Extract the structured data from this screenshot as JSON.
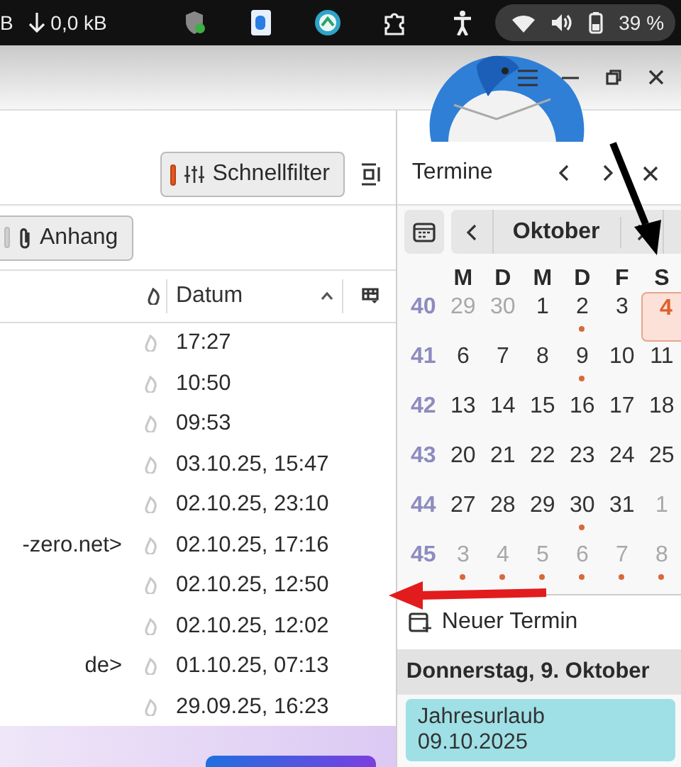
{
  "top_bar": {
    "net_fragment": "B",
    "download": "0,0 kB",
    "battery": "39 %"
  },
  "toolbar": {
    "quick_filter": {
      "label": "Schnellfilter",
      "on": true
    }
  },
  "filter_bar": {
    "attachment": {
      "label": "Anhang",
      "on": false
    }
  },
  "message_list": {
    "columns": [
      {
        "label": "Datum",
        "sorted": true
      }
    ],
    "rows": [
      {
        "date": "17:27"
      },
      {
        "date": "10:50"
      },
      {
        "date": "09:53"
      },
      {
        "date": "03.10.25, 15:47"
      },
      {
        "date": "02.10.25, 23:10"
      },
      {
        "column_1": "-zero.net>",
        "date": "02.10.25, 17:16"
      },
      {
        "date": "02.10.25, 12:50"
      },
      {
        "date": "02.10.25, 12:02"
      },
      {
        "column_1": "de>",
        "date": "01.10.25, 07:13"
      },
      {
        "date": "29.09.25, 16:23"
      }
    ]
  },
  "today_pane": {
    "title": "Termine",
    "month": "Oktober",
    "weekdays": [
      "M",
      "D",
      "M",
      "D",
      "F",
      "S"
    ],
    "weeks": [
      {
        "number": "40",
        "days": [
          {
            "label": "29",
            "muted": true,
            "event": false,
            "today": false
          },
          {
            "label": "30",
            "muted": true,
            "event": false,
            "today": false
          },
          {
            "label": "1",
            "muted": false,
            "event": false,
            "today": false
          },
          {
            "label": "2",
            "muted": false,
            "event": true,
            "today": false
          },
          {
            "label": "3",
            "muted": false,
            "event": false,
            "today": false
          },
          {
            "label": "4",
            "muted": false,
            "event": false,
            "today": true
          }
        ]
      },
      {
        "number": "41",
        "days": [
          {
            "label": "6",
            "muted": false,
            "event": false,
            "today": false
          },
          {
            "label": "7",
            "muted": false,
            "event": false,
            "today": false
          },
          {
            "label": "8",
            "muted": false,
            "event": false,
            "today": false
          },
          {
            "label": "9",
            "muted": false,
            "event": true,
            "today": false
          },
          {
            "label": "10",
            "muted": false,
            "event": false,
            "today": false
          },
          {
            "label": "11",
            "muted": false,
            "event": false,
            "today": false
          }
        ]
      },
      {
        "number": "42",
        "days": [
          {
            "label": "13",
            "muted": false,
            "event": false,
            "today": false
          },
          {
            "label": "14",
            "muted": false,
            "event": false,
            "today": false
          },
          {
            "label": "15",
            "muted": false,
            "event": false,
            "today": false
          },
          {
            "label": "16",
            "muted": false,
            "event": false,
            "today": false
          },
          {
            "label": "17",
            "muted": false,
            "event": false,
            "today": false
          },
          {
            "label": "18",
            "muted": false,
            "event": false,
            "today": false
          }
        ]
      },
      {
        "number": "43",
        "days": [
          {
            "label": "20",
            "muted": false,
            "event": false,
            "today": false
          },
          {
            "label": "21",
            "muted": false,
            "event": false,
            "today": false
          },
          {
            "label": "22",
            "muted": false,
            "event": false,
            "today": false
          },
          {
            "label": "23",
            "muted": false,
            "event": false,
            "today": false
          },
          {
            "label": "24",
            "muted": false,
            "event": false,
            "today": false
          },
          {
            "label": "25",
            "muted": false,
            "event": false,
            "today": false
          }
        ]
      },
      {
        "number": "44",
        "days": [
          {
            "label": "27",
            "muted": false,
            "event": false,
            "today": false
          },
          {
            "label": "28",
            "muted": false,
            "event": false,
            "today": false
          },
          {
            "label": "29",
            "muted": false,
            "event": false,
            "today": false
          },
          {
            "label": "30",
            "muted": false,
            "event": true,
            "today": false
          },
          {
            "label": "31",
            "muted": false,
            "event": false,
            "today": false
          },
          {
            "label": "1",
            "muted": true,
            "event": false,
            "today": false
          }
        ]
      },
      {
        "number": "45",
        "days": [
          {
            "label": "3",
            "muted": true,
            "event": true,
            "today": false
          },
          {
            "label": "4",
            "muted": true,
            "event": true,
            "today": false
          },
          {
            "label": "5",
            "muted": true,
            "event": true,
            "today": false
          },
          {
            "label": "6",
            "muted": true,
            "event": true,
            "today": false
          },
          {
            "label": "7",
            "muted": true,
            "event": true,
            "today": false
          },
          {
            "label": "8",
            "muted": true,
            "event": true,
            "today": false
          }
        ]
      }
    ],
    "new_event": "Neuer Termin",
    "day_header": "Donnerstag, 9. Oktober",
    "events": [
      {
        "title": "Jahresurlaub",
        "date": "09.10.2025"
      }
    ]
  }
}
